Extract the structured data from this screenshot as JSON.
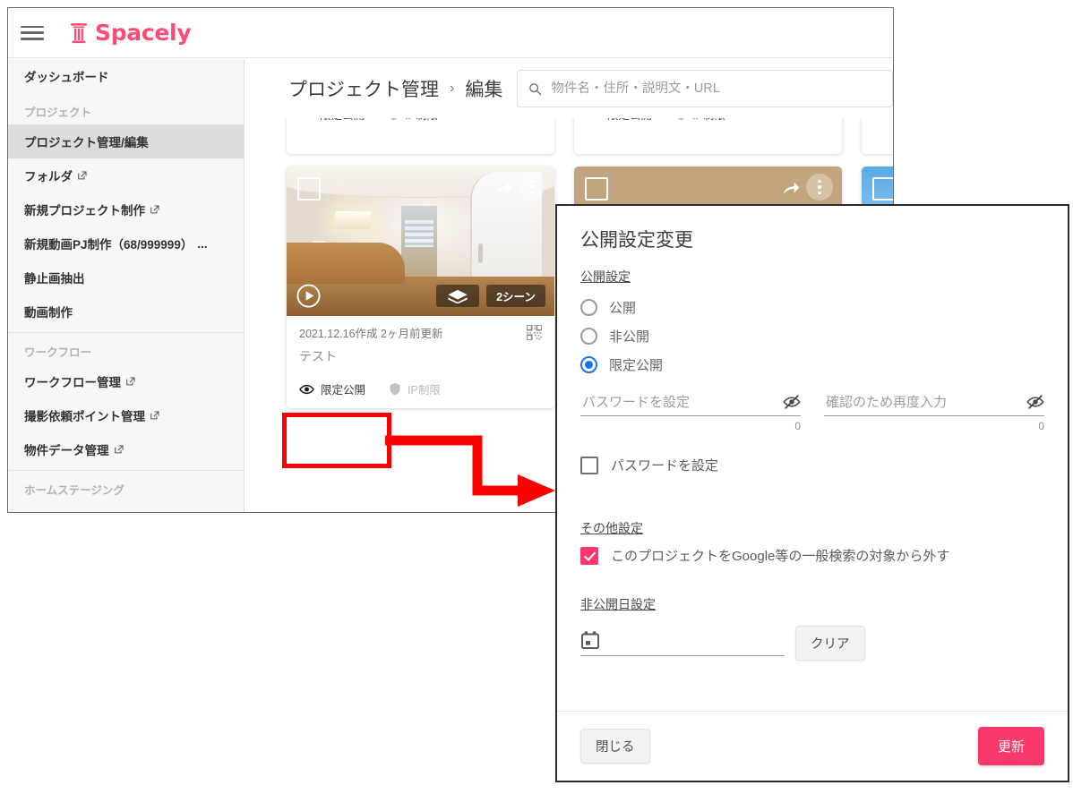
{
  "topbar": {
    "menu_icon": "hamburger-icon",
    "brand_name": "Spacely",
    "brand_color": "#f94d77",
    "brand_icon": "pillar-icon"
  },
  "sidebar": {
    "dashboard": "ダッシュボード",
    "groups": [
      {
        "heading": "プロジェクト",
        "items": [
          {
            "label": "プロジェクト管理/編集",
            "external": false,
            "active": true
          },
          {
            "label": "フォルダ",
            "external": true,
            "active": false
          },
          {
            "label": "新規プロジェクト制作",
            "external": true,
            "active": false
          },
          {
            "label": "新規動画PJ制作（68/999999）",
            "external": false,
            "active": false,
            "suffix": "..."
          },
          {
            "label": "静止画抽出",
            "external": false,
            "active": false
          },
          {
            "label": "動画制作",
            "external": false,
            "active": false
          }
        ]
      },
      {
        "heading": "ワークフロー",
        "items": [
          {
            "label": "ワークフロー管理",
            "external": true,
            "active": false
          },
          {
            "label": "撮影依頼ポイント管理",
            "external": true,
            "active": false
          },
          {
            "label": "物件データ管理",
            "external": true,
            "active": false
          }
        ]
      },
      {
        "heading": "ホームステージング",
        "items": []
      }
    ]
  },
  "header": {
    "breadcrumb": [
      "プロジェクト管理",
      "編集"
    ],
    "separator": "›",
    "search": {
      "icon": "search-icon",
      "placeholder": "物件名・住所・説明文・URL",
      "value": ""
    }
  },
  "cards_clipped": [
    {
      "status": "限定公開",
      "restriction": "IP制限"
    },
    {
      "status": "限定公開",
      "restriction": "IP制限"
    }
  ],
  "card": {
    "select_icon": "checkbox-square-icon",
    "share_icon": "share-icon",
    "menu_icon": "kebab-menu-icon",
    "play_icon": "play-icon",
    "vr_icon": "vr-goggles-icon",
    "scene_count": "2シーン",
    "date": "2021.12.16作成 2ヶ月前更新",
    "qr_icon": "qr-code-icon",
    "title": "テスト",
    "status_icon": "eye-icon",
    "status": "限定公開",
    "restriction_icon": "shield-icon",
    "restriction": "IP制限"
  },
  "annotation": {
    "highlight_color": "#fa0000",
    "arrow_icon": "arrow-right-icon"
  },
  "modal": {
    "title": "公開設定変更",
    "visibility_section_label": "公開設定",
    "radio_options": [
      {
        "label": "公開",
        "selected": false
      },
      {
        "label": "非公開",
        "selected": false
      },
      {
        "label": "限定公開",
        "selected": true
      }
    ],
    "radio_accent": "#1a73e8",
    "password_fields": [
      {
        "placeholder": "パスワードを設定",
        "value": "",
        "count": "0",
        "icon": "eye-off-icon"
      },
      {
        "placeholder": "確認のため再度入力",
        "value": "",
        "count": "0",
        "icon": "eye-off-icon"
      }
    ],
    "password_checkbox": {
      "label": "パスワードを設定",
      "checked": false
    },
    "other_section_label": "その他設定",
    "google_checkbox": {
      "label": "このプロジェクトをGoogle等の一般検索の対象から外す",
      "checked": true,
      "color": "#f9386c"
    },
    "unpublish_section_label": "非公開日設定",
    "date_field": {
      "icon": "calendar-icon",
      "placeholder": "",
      "value": ""
    },
    "clear_button": "クリア",
    "close_button": "閉じる",
    "update_button": "更新",
    "update_button_color": "#f9386c"
  }
}
